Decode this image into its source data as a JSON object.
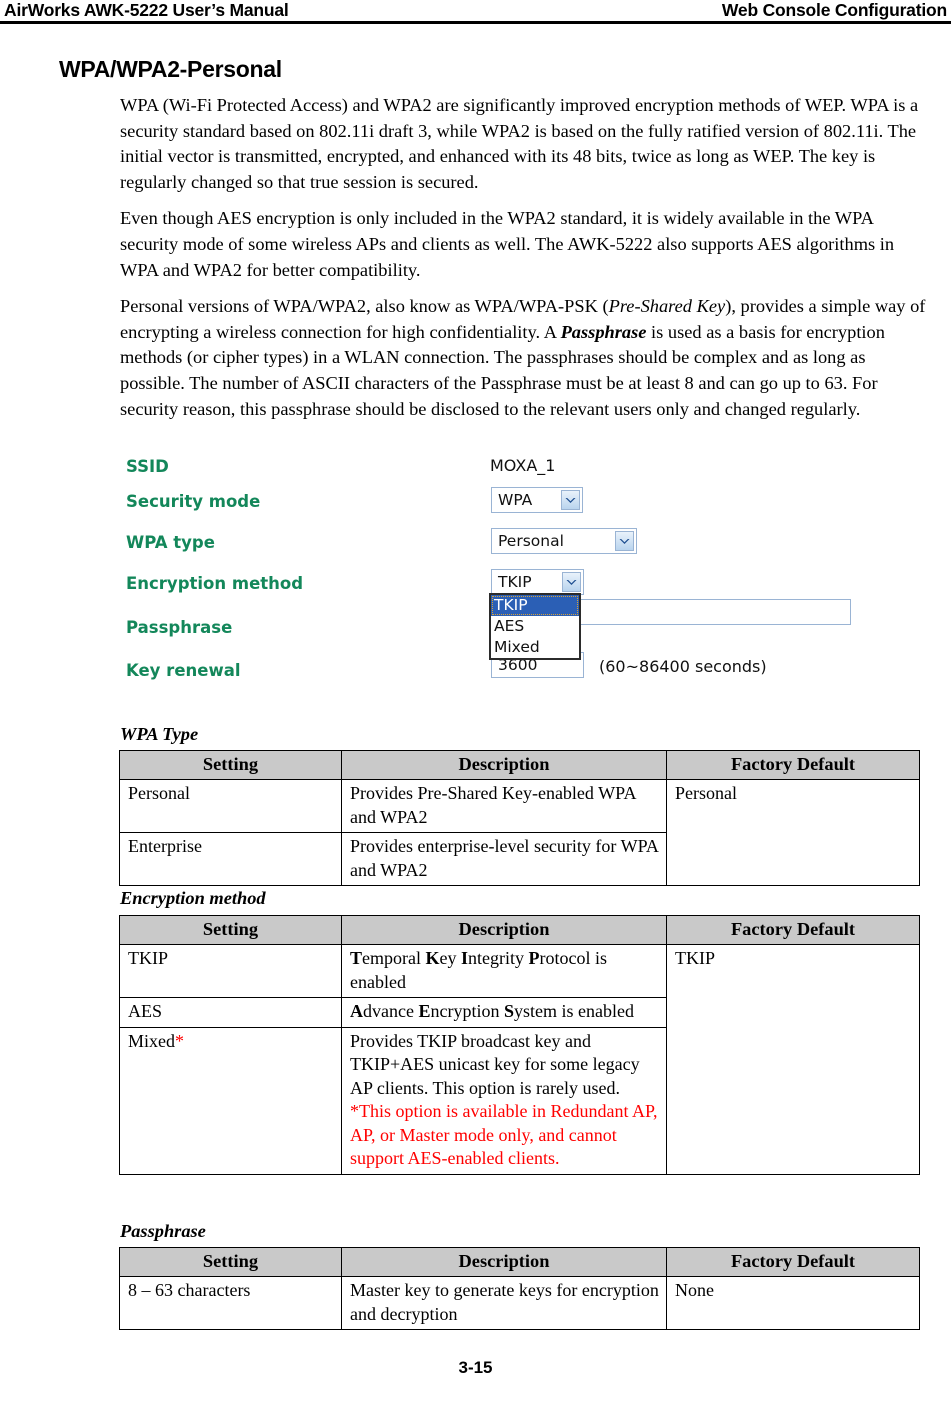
{
  "header": {
    "left": "AirWorks AWK-5222 User’s Manual",
    "right": "Web Console Configuration"
  },
  "section": {
    "title": "WPA/WPA2-Personal"
  },
  "paragraphs": {
    "p1": "WPA (Wi-Fi Protected Access) and WPA2 are significantly improved encryption methods of WEP. WPA is a security standard based on 802.11i draft 3, while WPA2 is based on the fully ratified version of 802.11i. The initial vector is transmitted, encrypted, and enhanced with its 48 bits, twice as long as WEP. The key is regularly changed so that true session is secured.",
    "p2": "Even though AES encryption is only included in the WPA2 standard, it is widely available in the WPA security mode of some wireless APs and clients as well. The AWK-5222 also supports AES algorithms in WPA and WPA2 for better compatibility.",
    "p3_a": "Personal versions of WPA/WPA2, also know as WPA/WPA-PSK (",
    "p3_italic1": "Pre-Shared Key",
    "p3_b": "), provides a simple way of encrypting a wireless connection for high confidentiality. A ",
    "p3_bolditalic": "Passphrase",
    "p3_c": " is used as a basis for encryption methods (or cipher types) in a WLAN connection. The passphrases should be complex and as long as possible. The number of ASCII characters of the Passphrase must be at least 8 and can go up to 63. For security reason, this passphrase should be disclosed to the relevant users only and changed regularly."
  },
  "console": {
    "labels": {
      "ssid": "SSID",
      "security_mode": "Security mode",
      "wpa_type": "WPA type",
      "encryption_method": "Encryption method",
      "passphrase": "Passphrase",
      "key_renewal": "Key renewal"
    },
    "values": {
      "ssid": "MOXA_1",
      "security_mode": "WPA",
      "wpa_type": "Personal",
      "encryption_method": "TKIP",
      "key_renewal": "3600"
    },
    "encryption_options": [
      "TKIP",
      "AES",
      "Mixed"
    ],
    "encryption_selected": "TKIP",
    "key_renewal_hint": "(60~86400 seconds)",
    "accent_label_color": "#13875A",
    "option_highlight_color": "#2b5fb5"
  },
  "tables": [
    {
      "caption": "WPA Type",
      "columns": [
        "Setting",
        "Description",
        "Factory Default"
      ],
      "rows": [
        {
          "setting": "Personal",
          "description": "Provides Pre-Shared Key-enabled WPA and WPA2",
          "factory_default": "Personal"
        },
        {
          "setting": "Enterprise",
          "description": "Provides enterprise-level security for WPA and WPA2",
          "factory_default": ""
        }
      ]
    },
    {
      "caption": "Encryption method",
      "columns": [
        "Setting",
        "Description",
        "Factory Default"
      ],
      "rows": [
        {
          "setting": "TKIP",
          "description": "Temporal Key Integrity Protocol is enabled",
          "factory_default": "TKIP"
        },
        {
          "setting": "AES",
          "description": "Advance Encryption System is enabled",
          "factory_default": ""
        },
        {
          "setting": "Mixed*",
          "description_black": "Provides TKIP broadcast key and TKIP+AES unicast key for some legacy AP clients. This option is rarely used. ",
          "description_red": "*This option is available in Redundant AP, AP, or Master mode only, and cannot support AES-enabled clients.",
          "factory_default": ""
        }
      ]
    },
    {
      "caption": "Passphrase",
      "columns": [
        "Setting",
        "Description",
        "Factory Default"
      ],
      "rows": [
        {
          "setting": "8 – 63 characters",
          "description": "Master key to generate keys for encryption and decryption",
          "factory_default": "None"
        }
      ]
    }
  ],
  "footer": {
    "page_number": "3-15"
  }
}
